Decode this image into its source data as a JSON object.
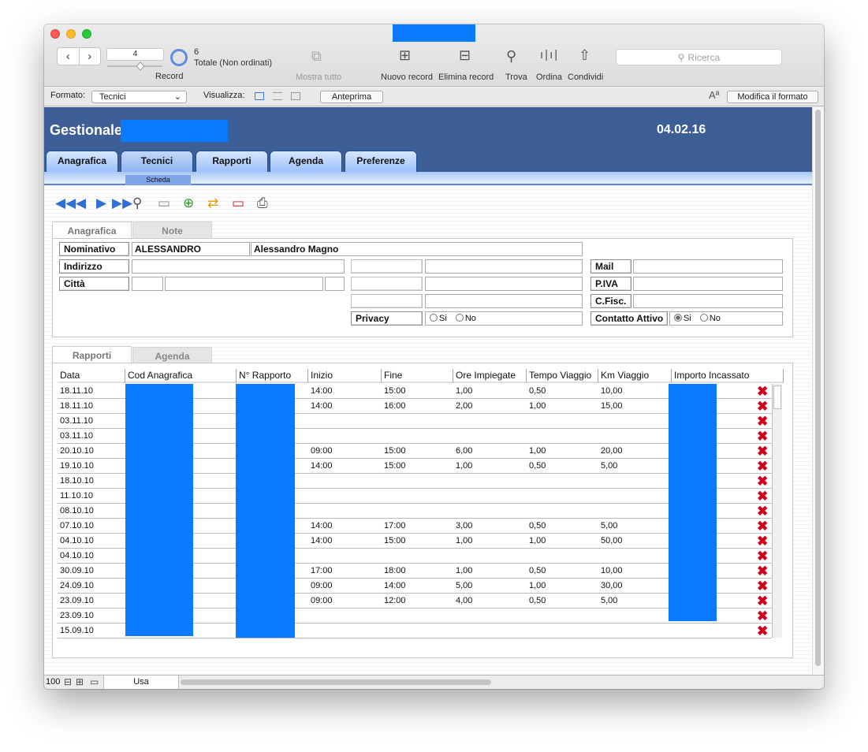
{
  "toolbar": {
    "record_value": "4",
    "record_label": "Record",
    "total_count": "6",
    "total_label": "Totale (Non ordinati)",
    "show_all": "Mostra tutto",
    "new_record": "Nuovo record",
    "delete_record": "Elimina record",
    "find": "Trova",
    "sort": "Ordina",
    "share": "Condividi",
    "search_placeholder": "Ricerca"
  },
  "formatbar": {
    "format_label": "Formato:",
    "format_value": "Tecnici",
    "view_label": "Visualizza:",
    "preview": "Anteprima",
    "edit_format": "Modifica il formato",
    "font_glyph": "Aª"
  },
  "app": {
    "title": "Gestionale",
    "date": "04.02.16",
    "tabs": [
      "Anagrafica",
      "Tecnici",
      "Rapporti",
      "Agenda",
      "Preferenze"
    ],
    "subtab": "Scheda",
    "accent": "#3e5f96"
  },
  "record": {
    "tabs": [
      "Anagrafica",
      "Note"
    ],
    "nominativo_label": "Nominativo",
    "nominativo_value": "ALESSANDRO",
    "nominativo_full": "Alessandro Magno",
    "indirizzo_label": "Indirizzo",
    "citta_label": "Città",
    "mail_label": "Mail",
    "piva_label": "P.IVA",
    "cfisc_label": "C.Fisc.",
    "privacy_label": "Privacy",
    "contatto_label": "Contatto Attivo",
    "si": "Si",
    "no": "No"
  },
  "rapporti": {
    "tabs": [
      "Rapporti",
      "Agenda"
    ],
    "columns": [
      "Data",
      "Cod Anagrafica",
      "N° Rapporto",
      "Inizio",
      "Fine",
      "Ore Impiegate",
      "Tempo Viaggio",
      "Km Viaggio",
      "Importo Incassato"
    ],
    "rows": [
      {
        "data": "18.11.10",
        "inizio": "14:00",
        "fine": "15:00",
        "ore": "1,00",
        "viaggio": "0,50",
        "km": "10,00"
      },
      {
        "data": "18.11.10",
        "inizio": "14:00",
        "fine": "16:00",
        "ore": "2,00",
        "viaggio": "1,00",
        "km": "15,00"
      },
      {
        "data": "03.11.10",
        "inizio": "",
        "fine": "",
        "ore": "",
        "viaggio": "",
        "km": ""
      },
      {
        "data": "03.11.10",
        "inizio": "",
        "fine": "",
        "ore": "",
        "viaggio": "",
        "km": ""
      },
      {
        "data": "20.10.10",
        "inizio": "09:00",
        "fine": "15:00",
        "ore": "6,00",
        "viaggio": "1,00",
        "km": "20,00"
      },
      {
        "data": "19.10.10",
        "inizio": "14:00",
        "fine": "15:00",
        "ore": "1,00",
        "viaggio": "0,50",
        "km": "5,00"
      },
      {
        "data": "18.10.10",
        "inizio": "",
        "fine": "",
        "ore": "",
        "viaggio": "",
        "km": ""
      },
      {
        "data": "11.10.10",
        "inizio": "",
        "fine": "",
        "ore": "",
        "viaggio": "",
        "km": ""
      },
      {
        "data": "08.10.10",
        "inizio": "",
        "fine": "",
        "ore": "",
        "viaggio": "",
        "km": ""
      },
      {
        "data": "07.10.10",
        "inizio": "14:00",
        "fine": "17:00",
        "ore": "3,00",
        "viaggio": "0,50",
        "km": "5,00"
      },
      {
        "data": "04.10.10",
        "inizio": "14:00",
        "fine": "15:00",
        "ore": "1,00",
        "viaggio": "1,00",
        "km": "50,00"
      },
      {
        "data": "04.10.10",
        "inizio": "",
        "fine": "",
        "ore": "",
        "viaggio": "",
        "km": ""
      },
      {
        "data": "30.09.10",
        "inizio": "17:00",
        "fine": "18:00",
        "ore": "1,00",
        "viaggio": "0,50",
        "km": "10,00"
      },
      {
        "data": "24.09.10",
        "inizio": "09:00",
        "fine": "14:00",
        "ore": "5,00",
        "viaggio": "1,00",
        "km": "30,00"
      },
      {
        "data": "23.09.10",
        "inizio": "09:00",
        "fine": "12:00",
        "ore": "4,00",
        "viaggio": "0,50",
        "km": "5,00"
      },
      {
        "data": "23.09.10",
        "inizio": "",
        "fine": "",
        "ore": "",
        "viaggio": "",
        "km": ""
      },
      {
        "data": "15.09.10",
        "inizio": "",
        "fine": "",
        "ore": "",
        "viaggio": "",
        "km": ""
      }
    ]
  },
  "status": {
    "zoom": "100",
    "mode": "Usa"
  }
}
